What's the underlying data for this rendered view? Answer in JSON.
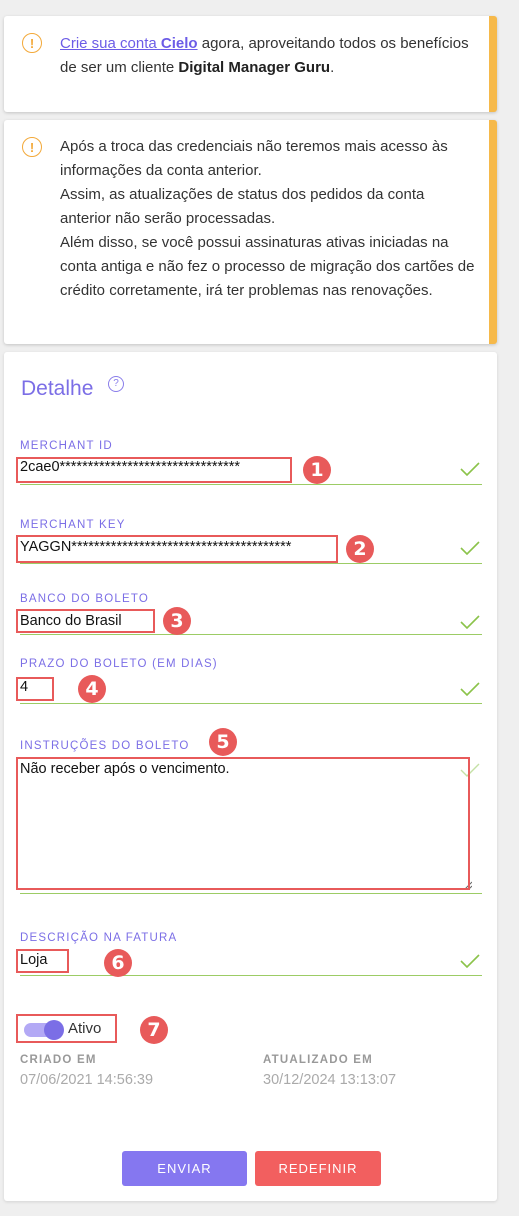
{
  "alert1": {
    "link_text": "Crie sua conta Cielo",
    "link_prefix": "Crie sua conta ",
    "link_brand": "Cielo",
    "text_after": " agora, aproveitando todos os benefícios de ser um cliente ",
    "brand": "Digital Manager Guru",
    "end": "."
  },
  "alert2": {
    "text": "Após a troca das credenciais não teremos mais acesso às informações da conta anterior.",
    "text2": "Assim, as atualizações de status dos pedidos da conta anterior não serão processadas.",
    "text3": "Além disso, se você possui assinaturas ativas iniciadas na conta antiga e não fez o processo de migração dos cartões de crédito corretamente, irá ter problemas nas renovações."
  },
  "detail": {
    "title": "Detalhe",
    "help": "?",
    "merchant_id": {
      "label": "MERCHANT ID",
      "value": "2cae0********************************"
    },
    "merchant_key": {
      "label": "MERCHANT KEY",
      "value": "YAGGN***************************************"
    },
    "bank": {
      "label": "BANCO DO BOLETO",
      "value": "Banco do Brasil"
    },
    "due_days": {
      "label": "PRAZO DO BOLETO (EM DIAS)",
      "value": "4"
    },
    "instructions": {
      "label": "INSTRUÇÕES DO BOLETO",
      "value": "Não receber após o vencimento."
    },
    "invoice_desc": {
      "label": "DESCRIÇÃO NA FATURA",
      "value": "Loja"
    },
    "active": {
      "label": "Ativo",
      "on": true
    },
    "created": {
      "label": "CRIADO EM",
      "value": "07/06/2021 14:56:39"
    },
    "updated": {
      "label": "ATUALIZADO EM",
      "value": "30/12/2024 13:13:07"
    },
    "send_label": "ENVIAR",
    "reset_label": "REDEFINIR"
  },
  "badges": [
    "1",
    "2",
    "3",
    "4",
    "5",
    "6",
    "7"
  ],
  "colors": {
    "accent": "#7b6ee6",
    "warning": "#f6b94a",
    "valid": "#9ccc65",
    "marker": "#e85a5a"
  }
}
